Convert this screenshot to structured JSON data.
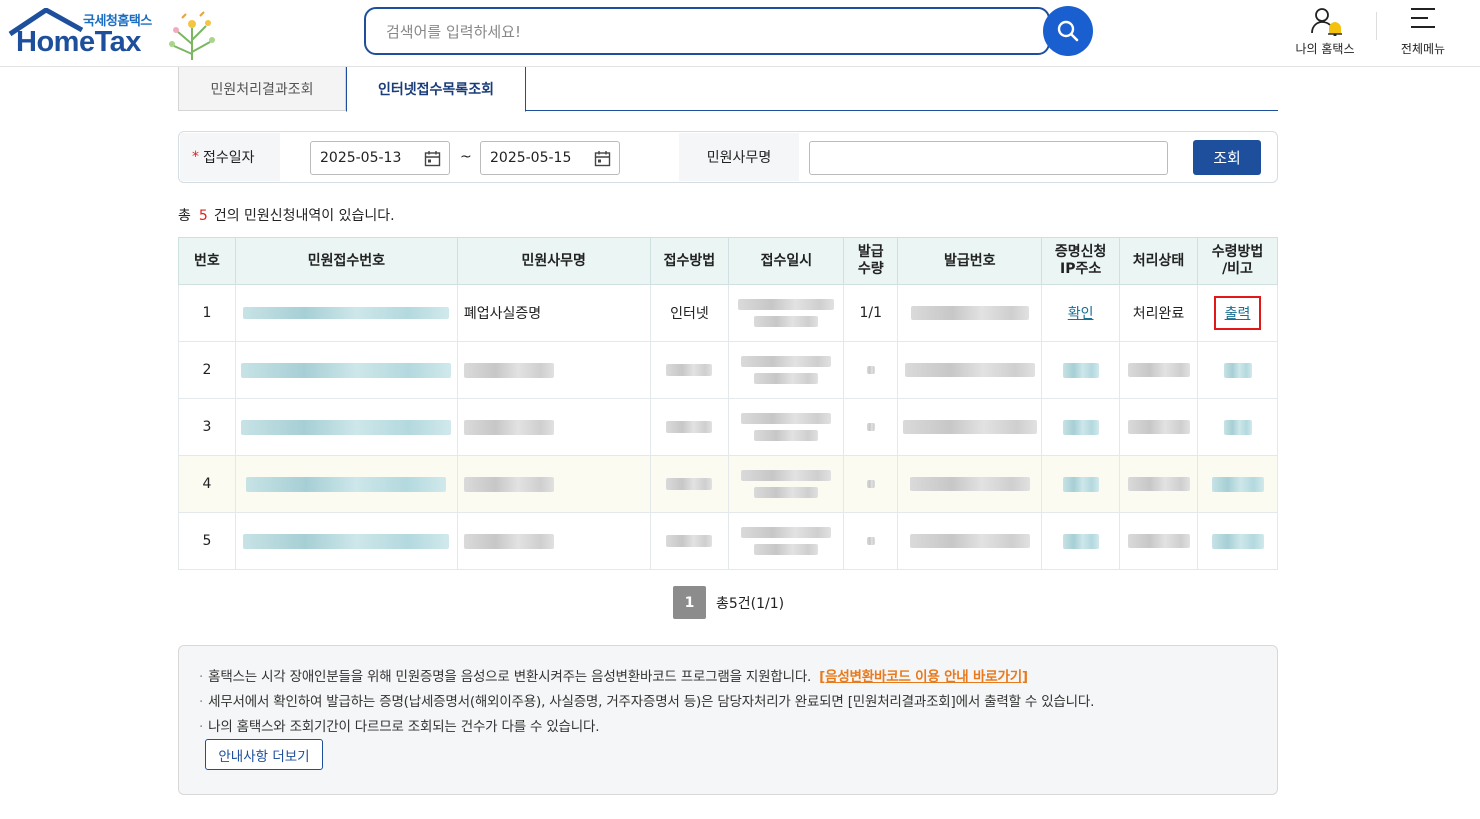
{
  "header": {
    "logo_sub": "국세청홈택스",
    "logo_main": "HomeTax",
    "search_placeholder": "검색어를 입력하세요!",
    "my_hometax": "나의 홈택스",
    "all_menu": "전체메뉴"
  },
  "tabs": [
    {
      "label": "민원처리결과조회",
      "active": false
    },
    {
      "label": "인터넷접수목록조회",
      "active": true
    }
  ],
  "filter": {
    "required_mark": "*",
    "date_label": "접수일자",
    "date_from": "2025-05-13",
    "date_sep": "~",
    "date_to": "2025-05-15",
    "name_label": "민원사무명",
    "name_value": "",
    "query_button": "조회"
  },
  "summary": {
    "prefix": "총",
    "count": "5",
    "suffix": "건의 민원신청내역이 있습니다."
  },
  "table": {
    "headers": [
      "번호",
      "민원접수번호",
      "민원사무명",
      "접수방법",
      "접수일시",
      "발급\n수량",
      "발급번호",
      "증명신청\nIP주소",
      "처리상태",
      "수령방법\n/비고"
    ],
    "rows": [
      {
        "no": "1",
        "name": "폐업사실증명",
        "method": "인터넷",
        "qty": "1/1",
        "ip": "확인",
        "status": "처리완료",
        "receipt": "출력"
      },
      {
        "no": "2"
      },
      {
        "no": "3"
      },
      {
        "no": "4"
      },
      {
        "no": "5"
      }
    ]
  },
  "pagination": {
    "current_page": "1",
    "info": "총5건(1/1)"
  },
  "notice": {
    "lines": [
      "홈택스는 시각 장애인분들을 위해 민원증명을 음성으로 변환시켜주는 음성변환바코드 프로그램을 지원합니다.",
      "세무서에서 확인하여 발급하는 증명(납세증명서(해외이주용), 사실증명, 거주자증명서 등)은 담당자처리가 완료되면 [민원처리결과조회]에서 출력할 수 있습니다.",
      "나의 홈택스와 조회기간이 다르므로 조회되는 건수가 다를 수 있습니다."
    ],
    "barcode_link": "[음성변환바코드 이용 안내 바로가기]",
    "more_button": "안내사항 더보기"
  },
  "colors": {
    "brand": "#1e4f9c",
    "search_button": "#1a5fd0",
    "required": "#e02020",
    "link": "#1a6f94",
    "highlight_border": "#e01818",
    "notice_link": "#e87a1d"
  }
}
